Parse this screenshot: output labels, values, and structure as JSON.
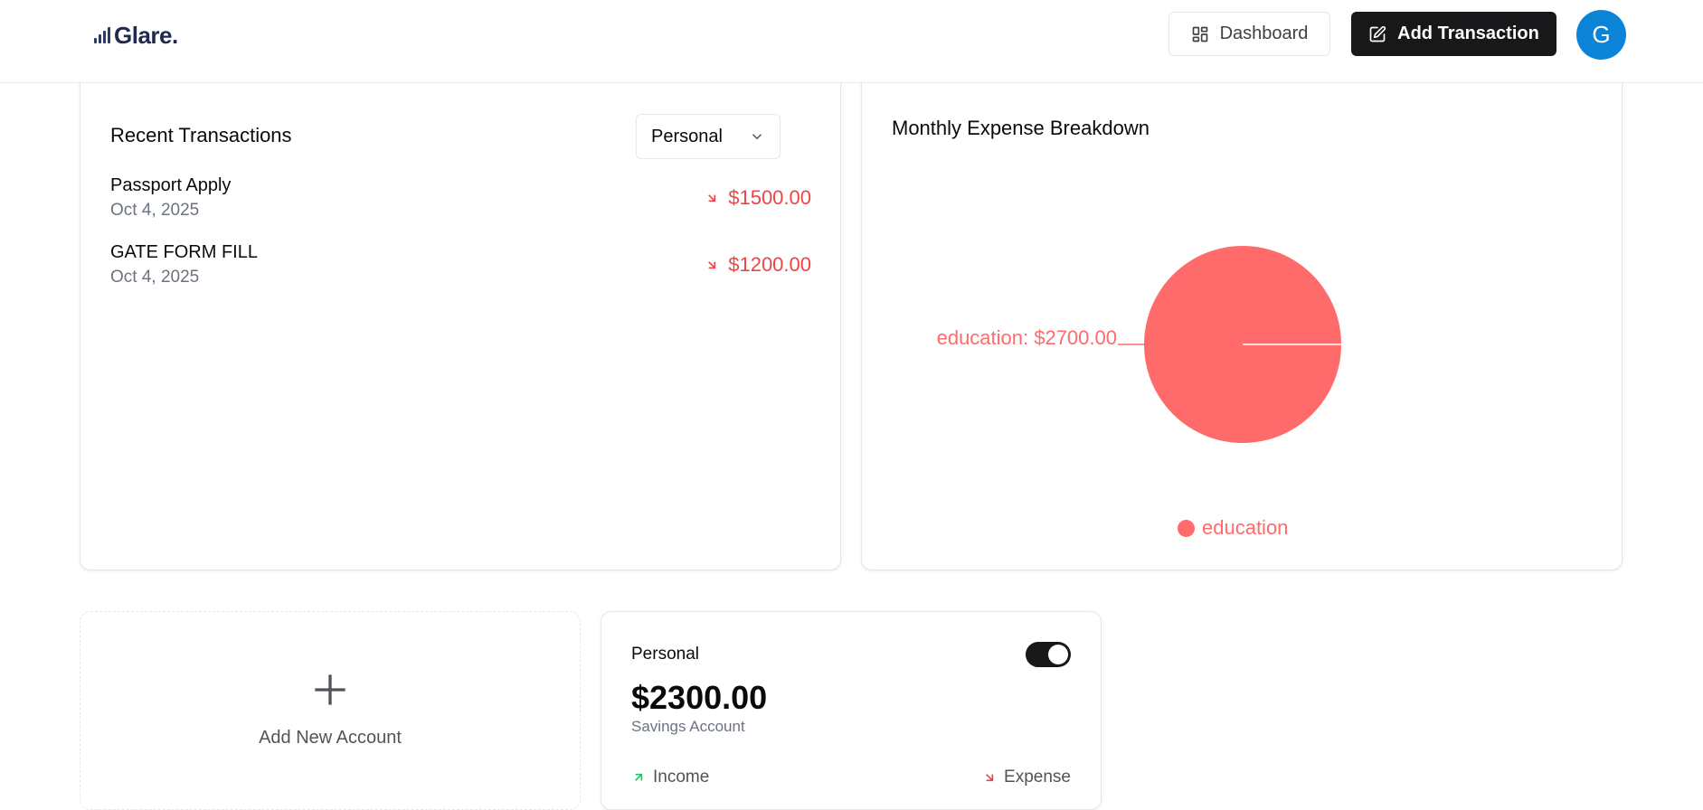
{
  "header": {
    "logo_text": "Glare.",
    "dashboard_label": "Dashboard",
    "add_transaction_label": "Add Transaction",
    "avatar_initial": "G"
  },
  "recent": {
    "title": "Recent Transactions",
    "filter_value": "Personal",
    "transactions": [
      {
        "name": "Passport Apply",
        "date": "Oct 4, 2025",
        "amount": "$1500.00",
        "type": "expense"
      },
      {
        "name": "GATE FORM FILL",
        "date": "Oct 4, 2025",
        "amount": "$1200.00",
        "type": "expense"
      }
    ]
  },
  "chart": {
    "title": "Monthly Expense Breakdown",
    "slice_label": "education: $2700.00",
    "legend_label": "education"
  },
  "chart_data": {
    "type": "pie",
    "title": "Monthly Expense Breakdown",
    "categories": [
      "education"
    ],
    "values": [
      2700.0
    ],
    "colors": [
      "#ff6b6b"
    ],
    "legend": "bottom"
  },
  "accounts": {
    "add_label": "Add New Account",
    "card": {
      "name": "Personal",
      "default_on": true,
      "balance": "$2300.00",
      "type": "Savings Account",
      "income_label": "Income",
      "expense_label": "Expense"
    }
  },
  "colors": {
    "expense": "#ef4444",
    "income": "#22c55e",
    "pie": "#ff6b6b",
    "primary": "#18181b",
    "avatar": "#0b84d8"
  }
}
